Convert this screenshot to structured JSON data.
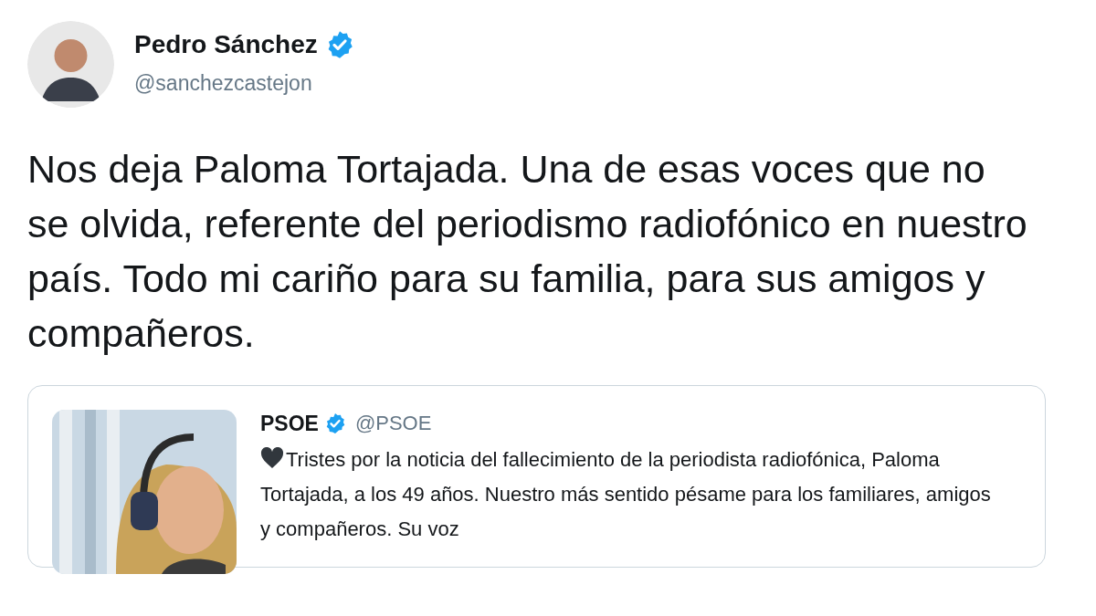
{
  "author": {
    "name": "Pedro Sánchez",
    "verified": true,
    "handle": "@sanchezcastejon"
  },
  "text": "Nos deja Paloma Tortajada. Una de esas voces que no se olvida, referente del periodismo radiofónico en nuestro país. Todo mi cariño para su familia, para sus amigos y compañeros.",
  "quoted_tweet": {
    "name": "PSOE",
    "verified": true,
    "handle": "@PSOE",
    "text": "Tristes por la noticia del fallecimiento de la periodista radiofónica, Paloma Tortajada, a los 49 años. Nuestro más sentido pésame para los familiares, amigos y compañeros. Su voz"
  }
}
